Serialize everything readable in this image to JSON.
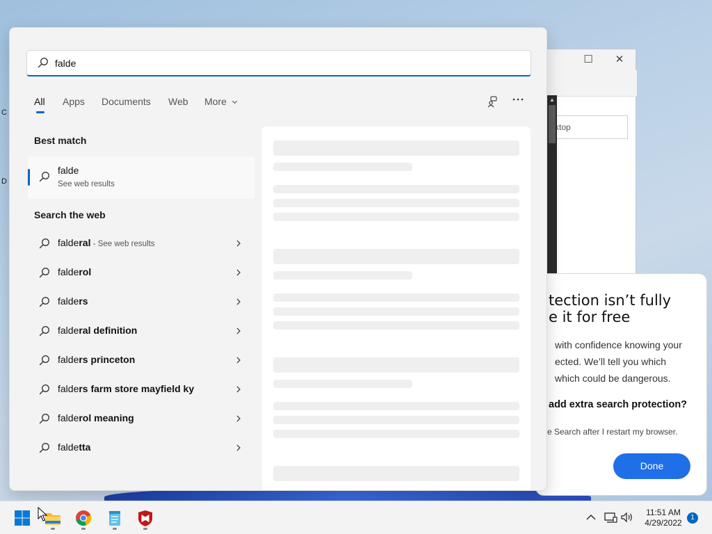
{
  "search": {
    "value": "falde",
    "placeholder": ""
  },
  "tabs": [
    {
      "label": "All",
      "active": true
    },
    {
      "label": "Apps",
      "active": false
    },
    {
      "label": "Documents",
      "active": false
    },
    {
      "label": "Web",
      "active": false
    },
    {
      "label": "More",
      "active": false
    }
  ],
  "best_match": {
    "heading": "Best match",
    "title": "falde",
    "subtitle": "See web results"
  },
  "web": {
    "heading": "Search the web",
    "items": [
      {
        "typed": "falde",
        "rest": "ral",
        "hint": " - See web results"
      },
      {
        "typed": "falde",
        "rest": "rol",
        "hint": ""
      },
      {
        "typed": "falde",
        "rest": "rs",
        "hint": ""
      },
      {
        "typed": "falde",
        "rest": "ral definition",
        "hint": ""
      },
      {
        "typed": "falde",
        "rest": "rs princeton",
        "hint": ""
      },
      {
        "typed": "falde",
        "rest": "rs farm store mayfield ky",
        "hint": ""
      },
      {
        "typed": "falde",
        "rest": "rol meaning",
        "hint": ""
      },
      {
        "typed": "falde",
        "rest": "tta",
        "hint": ""
      }
    ]
  },
  "popup": {
    "headline_line1": "tection isn’t fully",
    "headline_line2": "e it for free",
    "body_line1": "with confidence knowing your",
    "body_line2": "ected. We’ll tell you which",
    "body_line3": " which could be dangerous.",
    "question": "add extra search protection?",
    "restart_note": "e Search after I restart my browser.",
    "done_label": "Done"
  },
  "background_window": {
    "address_text": "ktop"
  },
  "desktop": {
    "glyph_c": "C",
    "glyph_d": "D"
  },
  "taskbar": {
    "time": "11:51 AM",
    "date": "4/29/2022",
    "notification_count": "1",
    "apps": [
      "start-icon",
      "file-explorer-icon",
      "chrome-icon",
      "notepad-icon",
      "mcafee-icon"
    ]
  },
  "colors": {
    "accent": "#0067c0",
    "done_button": "#1f6fe8",
    "panel_bg": "#f3f3f3"
  }
}
